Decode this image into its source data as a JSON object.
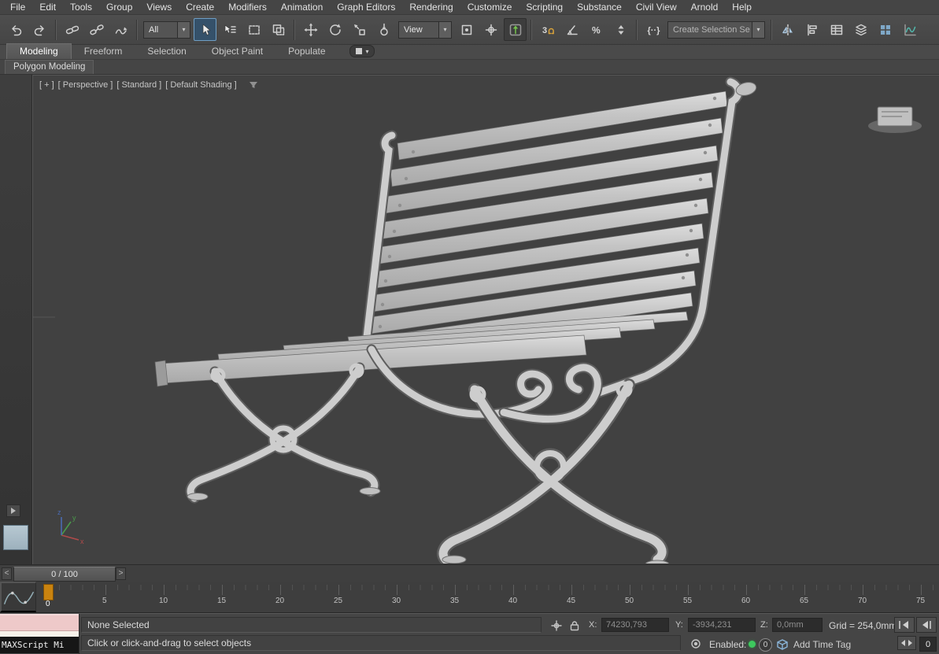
{
  "colors": {
    "ui_bg": "#454545",
    "viewport_bg": "#414141",
    "accent_blue": "#7fa8c8",
    "accent_green": "#3ec95e",
    "accent_orange": "#c9830f",
    "accent_teal": "#52b8ac"
  },
  "menu_bar": {
    "items": [
      "File",
      "Edit",
      "Tools",
      "Group",
      "Views",
      "Create",
      "Modifiers",
      "Animation",
      "Graph Editors",
      "Rendering",
      "Customize",
      "Scripting",
      "Substance",
      "Civil View",
      "Arnold",
      "Help"
    ]
  },
  "toolbar": {
    "filter_value": "All",
    "coord_value": "View",
    "selection_set_text": "Create Selection Se"
  },
  "icons": {
    "dd_arrow": "▾",
    "pill_arrow": "▾",
    "snap3": "3",
    "percent": "%",
    "named_sets": "{··}",
    "slider_prev": "<",
    "slider_next": ">"
  },
  "ribbon": {
    "tabs": [
      "Modeling",
      "Freeform",
      "Selection",
      "Object Paint",
      "Populate"
    ],
    "active_tab": "Modeling",
    "subtab": "Polygon Modeling"
  },
  "viewport": {
    "segments": [
      "[ + ]",
      "[ Perspective ]",
      "[ Standard ]",
      "[ Default Shading ]"
    ]
  },
  "timeline": {
    "frame_display": "0 / 100",
    "marker_label": "0",
    "ruler_labels": [
      "5",
      "10",
      "15",
      "20",
      "25",
      "30",
      "35",
      "40",
      "45",
      "50",
      "55",
      "60",
      "65",
      "70",
      "75"
    ]
  },
  "status_bar": {
    "maxscript_label": "MAXScript Mi",
    "selection_status": "None Selected",
    "prompt": "Click or click-and-drag to select objects",
    "coords": {
      "x_label": "X:",
      "x_value": "74230,793",
      "y_label": "Y:",
      "y_value": "-3934,231",
      "z_label": "Z:",
      "z_value": "0,0mm"
    },
    "grid_label": "Grid = 254,0mm",
    "enabled_label": "Enabled:",
    "zero_badge": "0",
    "add_time_tag": "Add Time Tag",
    "frame_field": "0"
  }
}
